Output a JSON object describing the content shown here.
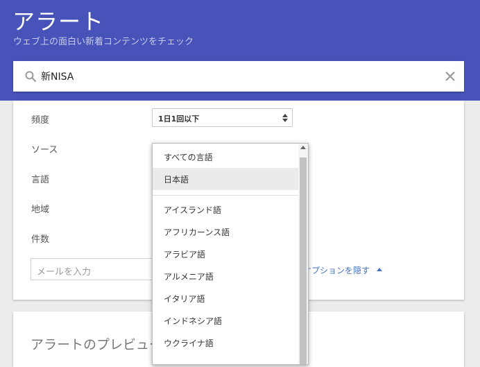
{
  "header": {
    "title": "アラート",
    "subtitle": "ウェブ上の面白い新着コンテンツをチェック"
  },
  "search": {
    "value": "新NISA"
  },
  "settings": {
    "frequency_label": "頻度",
    "frequency_value": "1日1回以下",
    "source_label": "ソース",
    "language_label": "言語",
    "region_label": "地域",
    "count_label": "件数",
    "email_placeholder": "メールを入力",
    "options_link": "オプションを隠す"
  },
  "preview": {
    "title": "アラートのプレビュー"
  },
  "language_dropdown": {
    "selected": "日本語",
    "options": [
      "すべての言語",
      "日本語",
      "アイスランド語",
      "アフリカーンス語",
      "アラビア語",
      "アルメニア語",
      "イタリア語",
      "インドネシア語",
      "ウクライナ語"
    ]
  },
  "colors": {
    "header_bg": "#4753b8",
    "link": "#4472c4",
    "selected_bg": "#ebebeb"
  }
}
